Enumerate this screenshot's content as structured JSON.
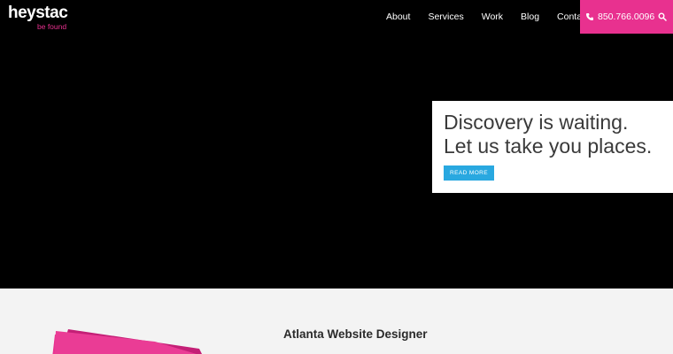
{
  "brand": {
    "name": "heystac",
    "tagline": "be found"
  },
  "nav": {
    "items": [
      {
        "label": "About"
      },
      {
        "label": "Services"
      },
      {
        "label": "Work"
      },
      {
        "label": "Blog"
      },
      {
        "label": "Contact"
      }
    ],
    "phone": "850.766.0096",
    "phone_icon": "phone-icon",
    "search_icon": "search-icon"
  },
  "hero": {
    "line1": "Discovery is waiting.",
    "line2": "Let us take you places.",
    "cta_label": "READ MORE"
  },
  "section": {
    "title": "Atlanta Website Designer"
  },
  "colors": {
    "accent_pink": "#e8318f",
    "button_blue": "#29a8e0",
    "header_bg": "#000000",
    "section_bg": "#f3f3f3"
  }
}
